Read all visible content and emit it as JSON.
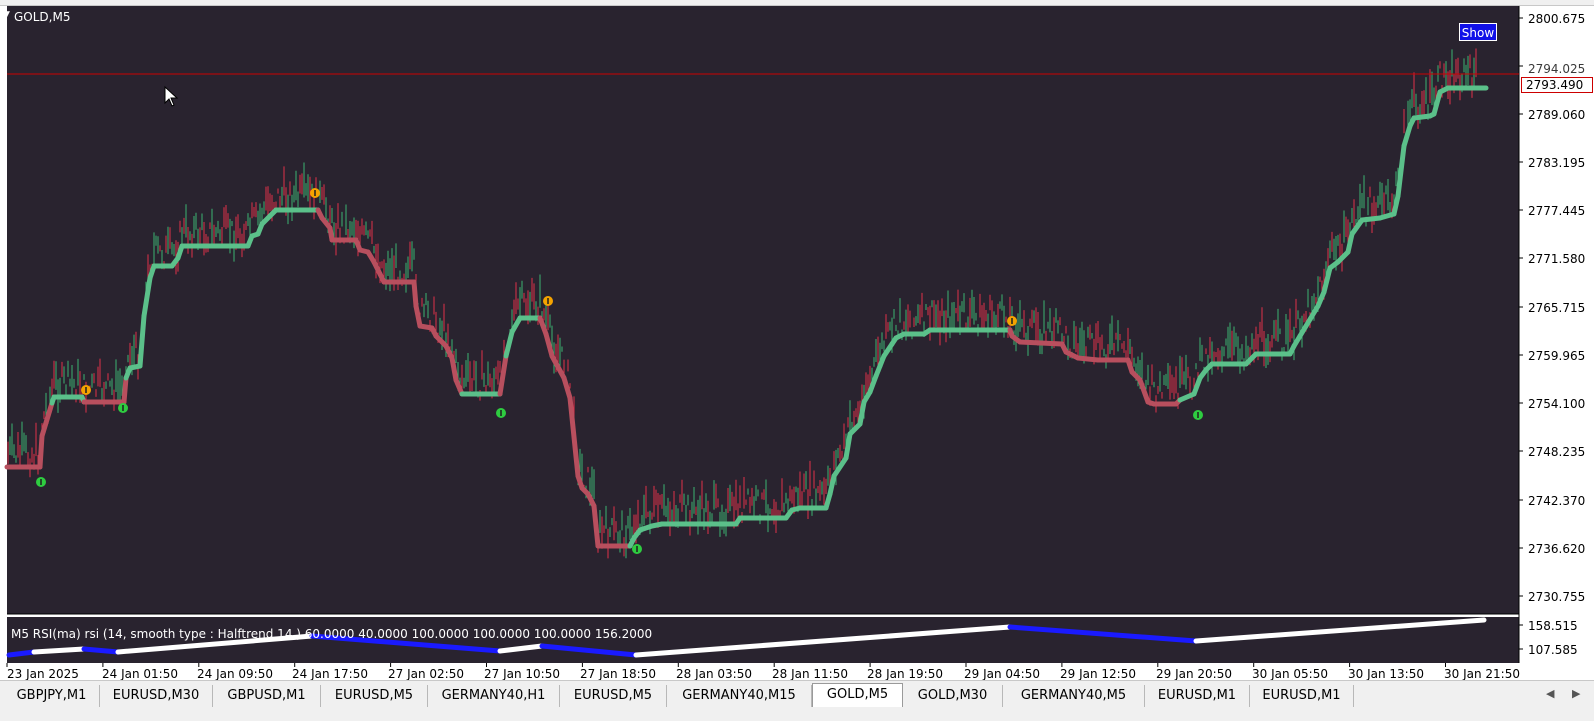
{
  "chart": {
    "symbol": "GOLD,M5",
    "show_button": "Show",
    "current_price": "2793.490",
    "current_price_hidden": "2794.025",
    "price_axis": [
      "2800.675",
      "2789.060",
      "2783.195",
      "2777.445",
      "2771.580",
      "2765.715",
      "2759.965",
      "2754.100",
      "2748.235",
      "2742.370",
      "2736.620",
      "2730.755"
    ],
    "time_axis": [
      "23 Jan 2025",
      "24 Jan 01:50",
      "24 Jan 09:50",
      "24 Jan 17:50",
      "27 Jan 02:50",
      "27 Jan 10:50",
      "27 Jan 18:50",
      "28 Jan 03:50",
      "28 Jan 11:50",
      "28 Jan 19:50",
      "29 Jan 04:50",
      "29 Jan 12:50",
      "29 Jan 20:50",
      "30 Jan 05:50",
      "30 Jan 13:50",
      "30 Jan 21:50"
    ],
    "rsi_caption": "M5 RSI(ma) rsi (14, smooth type : Halftrend  14 ) 60.0000 40.0000 100.0000 100.0000 100.0000 156.2000",
    "rsi_axis": [
      "158.515",
      "107.585"
    ],
    "colors": {
      "background": "#29232f",
      "up_trend": "#5bc08a",
      "down_trend": "#b84f5e",
      "bull_candle": "#3cb371",
      "bear_candle": "#e0304a",
      "price_line": "#cc0000",
      "rsi_up": "#ffffff",
      "rsi_down": "#1a1aff",
      "signal_up": "#2ecc40",
      "signal_down": "#f5a300"
    }
  },
  "tabs": [
    {
      "label": "GBPJPY,M1",
      "active": false
    },
    {
      "label": "EURUSD,M30",
      "active": false
    },
    {
      "label": "GBPUSD,M1",
      "active": false
    },
    {
      "label": "EURUSD,M5",
      "active": false
    },
    {
      "label": "GERMANY40,H1",
      "active": false
    },
    {
      "label": "EURUSD,M5",
      "active": false
    },
    {
      "label": "GERMANY40,M15",
      "active": false
    },
    {
      "label": "GOLD,M5",
      "active": true
    },
    {
      "label": "GOLD,M30",
      "active": false
    },
    {
      "label": "GERMANY40,M5",
      "active": false
    },
    {
      "label": "EURUSD,M1",
      "active": false
    },
    {
      "label": "EURUSD,M1",
      "active": false
    }
  ]
}
